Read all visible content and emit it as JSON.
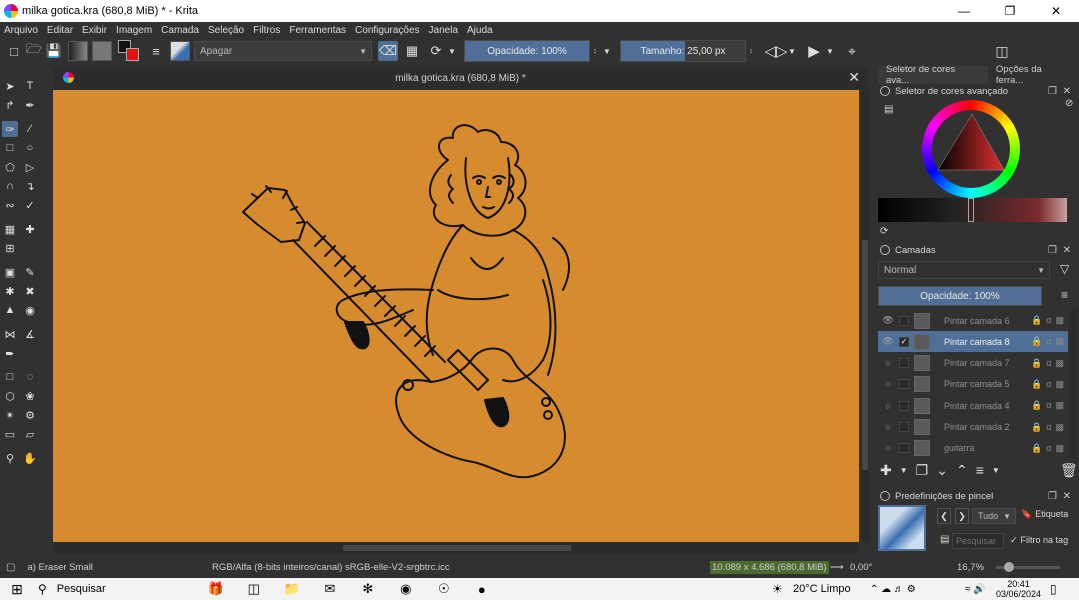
{
  "window": {
    "title": "milka gotica.kra (680,8 MiB) * - Krita",
    "minimize_icon": "minimize-icon",
    "maximize_icon": "restore-icon",
    "close_icon": "close-icon"
  },
  "menu": [
    "Arquivo",
    "Editar",
    "Exibir",
    "Imagem",
    "Camada",
    "Seleção",
    "Filtros",
    "Ferramentas",
    "Configurações",
    "Janela",
    "Ajuda"
  ],
  "toolbar": {
    "brush_preset": "Apagar",
    "opacity_label": "Opacidade: 100%",
    "opacity_value": 1.0,
    "size_label": "Tamanho: 25,00 px",
    "size_fill_fraction": 0.52,
    "colors": {
      "foreground": "#111111",
      "background": "#e81010",
      "accent": "#4f6f96"
    }
  },
  "document": {
    "tab_title": "milka gotica.kra (680,8 MiB) *",
    "canvas_color": "#d68b2e"
  },
  "dock": {
    "tabs": [
      "Seletor de cores ava...",
      "Opções da ferra..."
    ],
    "color_selector_title": "Seletor de cores avançado",
    "layers_title": "Camadas",
    "blend_mode": "Normal",
    "layer_opacity": "Opacidade:  100%",
    "layers": [
      {
        "name": "Pintar camada 6",
        "visible": true,
        "selected": false
      },
      {
        "name": "Pintar camada 8",
        "visible": true,
        "selected": true
      },
      {
        "name": "Pintar camada 7",
        "visible": false,
        "selected": false
      },
      {
        "name": "Pintar camada 5",
        "visible": false,
        "selected": false
      },
      {
        "name": "Pintar camada 4",
        "visible": false,
        "selected": false
      },
      {
        "name": "Pintar camada 2",
        "visible": false,
        "selected": false
      },
      {
        "name": "guitarra",
        "visible": false,
        "selected": false
      }
    ],
    "brush_presets_title": "Predefinições de pincel",
    "preset_filter": "Tudo",
    "tag_label": "Etiqueta",
    "search_placeholder": "Pesquisar",
    "filter_by_tag": "Filtro na tag"
  },
  "status": {
    "brush": "a) Eraser Small",
    "color_space": "RGB/Alfa (8-bits inteiros/canal)  sRGB-elle-V2-srgbtrc.icc",
    "dimensions": "10.089 x 4.686 (680,8 MiB)",
    "rotation": "0,00°",
    "zoom": "16,7%"
  },
  "taskbar": {
    "search": "Pesquisar",
    "weather": "20°C  Limpo",
    "time": "20:41",
    "date": "03/06/2024"
  }
}
